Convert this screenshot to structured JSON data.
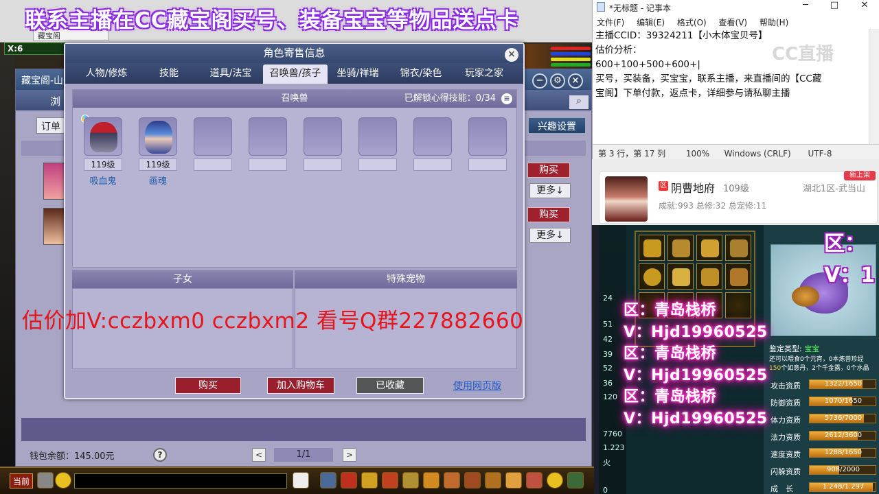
{
  "promo_banner": "联系主播在CC藏宝阁买号、装备宝宝等物品送点卡",
  "browser_tab": "藏宝阁",
  "game_hud": {
    "coords": "X:6"
  },
  "cbg_window": {
    "title": "藏宝阁-山",
    "nav_label": "浏",
    "order_button": "订单",
    "interest_button": "兴趣设置",
    "buy_label": "购买",
    "more_label": "更多↓",
    "wallet": "钱包余额：145.00元",
    "help": "?",
    "pager": {
      "prev": "<",
      "text": "1/1",
      "next": ">"
    }
  },
  "modal": {
    "title": "角色寄售信息",
    "close": "×",
    "tabs": [
      "人物/修炼",
      "技能",
      "道具/法宝",
      "召唤兽/孩子",
      "坐骑/祥瑞",
      "锦衣/染色",
      "玩家之家"
    ],
    "active_tab": 3,
    "panel_title": "召唤兽",
    "skill_info": "已解锁心得技能：0/34",
    "pets": [
      {
        "level": "119级",
        "name": "吸血鬼"
      },
      {
        "level": "119级",
        "name": "画魂"
      }
    ],
    "children_title": "子女",
    "special_pet_title": "特殊宠物",
    "buy_button": "购买",
    "cart_button": "加入购物车",
    "favorited_button": "已收藏",
    "web_link": "使用网页版"
  },
  "overlay_estimate": "估价加V:cczbxm0     cczbxm2   看号Q群227882660",
  "notepad": {
    "title": "*无标题 - 记事本",
    "controls": {
      "minimize": "─",
      "maximize": "□",
      "close": "✕"
    },
    "menu": [
      "文件(F)",
      "编辑(E)",
      "格式(O)",
      "查看(V)",
      "帮助(H)"
    ],
    "lines": [
      "主播CCID：39324211【小木体宝贝号】",
      "估价分析：",
      "600+100+500+600+|",
      "买号，买装备，买宝宝，联系主播，来直播间的【CC藏",
      "宝阁】下单付款，返点卡，详细参与请私聊主播"
    ],
    "status": {
      "position": "第 3 行，第 17 列",
      "zoom": "100%",
      "eol": "Windows (CRLF)",
      "encoding": "UTF-8"
    }
  },
  "cc_logo": "CC直播",
  "streamer_card": {
    "server_badge": "区",
    "name": "阴曹地府",
    "level": "109级",
    "server": "湖北1区-武当山",
    "stats": "成就:993 总修:32 总宠修:11",
    "new_badge": "新上架"
  },
  "game_right": {
    "left_numbers": [
      "24",
      "51",
      "42",
      "39",
      "52",
      "36",
      "120",
      "7760",
      "1.223",
      "火",
      "0"
    ],
    "appraisal_label": "鉴定类型:",
    "appraisal_value": "宝宝",
    "pet_desc_line1": "还可以喂食0个元宵，0本炼兽珍经",
    "pet_desc_line2_a": "150",
    "pet_desc_line2_b": "个如意丹，2个千金露，0个水晶",
    "stats": [
      {
        "label": "攻击资质",
        "value": "1322/1650",
        "fill": 0.8
      },
      {
        "label": "防御资质",
        "value": "1070/1650",
        "fill": 0.65
      },
      {
        "label": "体力资质",
        "value": "5736/7000",
        "fill": 0.82
      },
      {
        "label": "法力资质",
        "value": "2612/3600",
        "fill": 0.73
      },
      {
        "label": "速度资质",
        "value": "1288/1650",
        "fill": 0.78
      },
      {
        "label": "闪躲资质",
        "value": "908/2000",
        "fill": 0.45
      },
      {
        "label": "成　长",
        "value": "1.248/1.297",
        "fill": 0.96
      }
    ],
    "overlay_region": "区：",
    "overlay_v": "V：1"
  },
  "neon_lines": [
    "区：青岛栈桥",
    "V：Hjd19960525",
    "区：青岛栈桥",
    "V：Hjd19960525",
    "区：青岛栈桥",
    "V：Hjd19960525"
  ],
  "bottom_hud": {
    "current": "当前"
  }
}
